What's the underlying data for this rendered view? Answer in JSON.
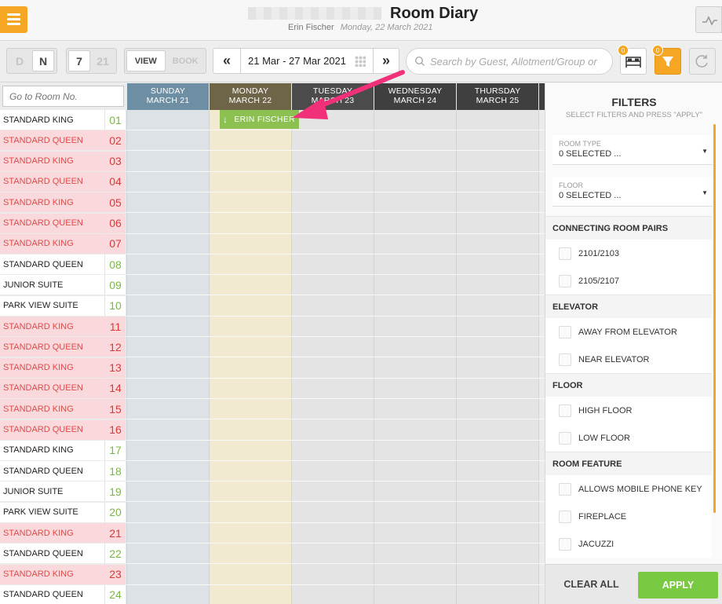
{
  "header": {
    "title": "Room Diary",
    "user": "Erin Fischer",
    "date": "Monday, 22 March 2021"
  },
  "toolbar": {
    "mode_day": "D",
    "mode_night": "N",
    "days_7": "7",
    "days_21": "21",
    "view_label": "VIEW",
    "book_label": "BOOK",
    "prev": "«",
    "next": "»",
    "date_range": "21 Mar - 27 Mar 2021",
    "search_placeholder": "Search by Guest, Allotment/Group or",
    "rooms_badge": "0",
    "filter_badge": "0"
  },
  "grid": {
    "goto_placeholder": "Go to Room No.",
    "days": [
      {
        "day": "SUNDAY",
        "date": "MARCH 21",
        "color": "#6e8fa3"
      },
      {
        "day": "MONDAY",
        "date": "MARCH 22",
        "color": "#6e6447"
      },
      {
        "day": "TUESDAY",
        "date": "MARCH 23",
        "color": "#4b4b4b"
      },
      {
        "day": "WEDNESDAY",
        "date": "MARCH 24",
        "color": "#3f3f3f"
      },
      {
        "day": "THURSDAY",
        "date": "MARCH 25",
        "color": "#3f3f3f"
      }
    ],
    "rooms": [
      {
        "type": "STANDARD KING",
        "num": "01",
        "status": "clean"
      },
      {
        "type": "STANDARD QUEEN",
        "num": "02",
        "status": "dirty"
      },
      {
        "type": "STANDARD KING",
        "num": "03",
        "status": "dirty"
      },
      {
        "type": "STANDARD QUEEN",
        "num": "04",
        "status": "dirty"
      },
      {
        "type": "STANDARD KING",
        "num": "05",
        "status": "dirty"
      },
      {
        "type": "STANDARD QUEEN",
        "num": "06",
        "status": "dirty"
      },
      {
        "type": "STANDARD KING",
        "num": "07",
        "status": "dirty"
      },
      {
        "type": "STANDARD QUEEN",
        "num": "08",
        "status": "clean"
      },
      {
        "type": "JUNIOR SUITE",
        "num": "09",
        "status": "clean"
      },
      {
        "type": "PARK VIEW SUITE",
        "num": "10",
        "status": "clean"
      },
      {
        "type": "STANDARD KING",
        "num": "11",
        "status": "dirty"
      },
      {
        "type": "STANDARD QUEEN",
        "num": "12",
        "status": "dirty"
      },
      {
        "type": "STANDARD KING",
        "num": "13",
        "status": "dirty"
      },
      {
        "type": "STANDARD QUEEN",
        "num": "14",
        "status": "dirty"
      },
      {
        "type": "STANDARD KING",
        "num": "15",
        "status": "dirty"
      },
      {
        "type": "STANDARD QUEEN",
        "num": "16",
        "status": "dirty"
      },
      {
        "type": "STANDARD KING",
        "num": "17",
        "status": "clean"
      },
      {
        "type": "STANDARD QUEEN",
        "num": "18",
        "status": "clean"
      },
      {
        "type": "JUNIOR SUITE",
        "num": "19",
        "status": "clean"
      },
      {
        "type": "PARK VIEW SUITE",
        "num": "20",
        "status": "clean"
      },
      {
        "type": "STANDARD KING",
        "num": "21",
        "status": "dirty"
      },
      {
        "type": "STANDARD QUEEN",
        "num": "22",
        "status": "clean"
      },
      {
        "type": "STANDARD KING",
        "num": "23",
        "status": "dirty"
      },
      {
        "type": "STANDARD QUEEN",
        "num": "24",
        "status": "clean"
      }
    ],
    "booking": {
      "guest": "ERIN FISCHER",
      "icon": "arrow-down-icon"
    }
  },
  "filters": {
    "title": "FILTERS",
    "subtitle": "SELECT FILTERS AND PRESS \"APPLY\"",
    "room_type": {
      "label": "ROOM TYPE",
      "value": "0 SELECTED ..."
    },
    "floor_select": {
      "label": "FLOOR",
      "value": "0 SELECTED ..."
    },
    "sections": [
      {
        "title": "CONNECTING ROOM PAIRS",
        "options": [
          "2101/2103",
          "2105/2107"
        ]
      },
      {
        "title": "ELEVATOR",
        "options": [
          "AWAY FROM ELEVATOR",
          "NEAR ELEVATOR"
        ]
      },
      {
        "title": "FLOOR",
        "options": [
          "HIGH FLOOR",
          "LOW FLOOR"
        ]
      },
      {
        "title": "ROOM FEATURE",
        "options": [
          "ALLOWS MOBILE PHONE KEY",
          "FIREPLACE",
          "JACUZZI"
        ]
      }
    ],
    "clear_label": "CLEAR ALL",
    "apply_label": "APPLY"
  },
  "colors": {
    "accent": "#f5a623",
    "apply_green": "#7ac943",
    "booking_green": "#8cc152",
    "dirty_bg": "#f9d9dc",
    "dirty_text": "#e04a4a",
    "clean_num": "#7ab843",
    "annotation_arrow": "#f0317a"
  }
}
